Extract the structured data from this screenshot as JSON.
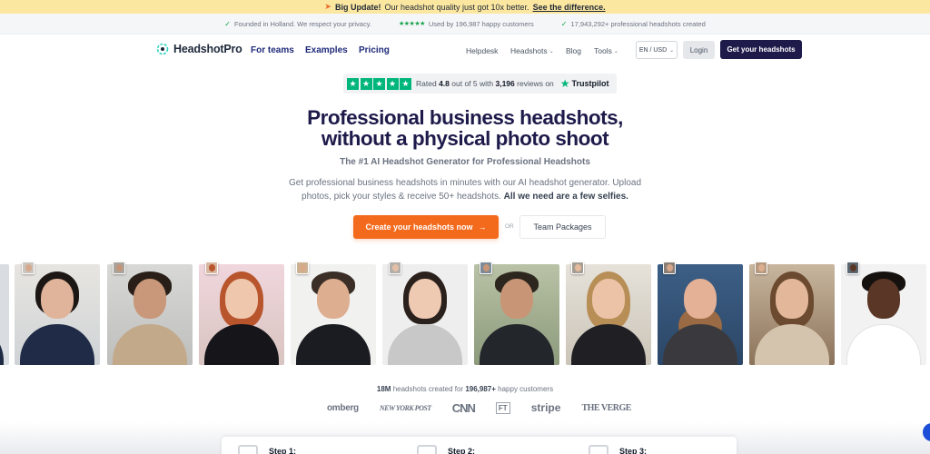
{
  "announcement": {
    "icon": "rocket-icon",
    "bold": "Big Update!",
    "text": "Our headshot quality just got 10x better.",
    "link": "See the difference."
  },
  "trustbar": [
    {
      "icon": "check-icon",
      "text": "Founded in Holland. We respect your privacy."
    },
    {
      "icon": "star-icon",
      "text": "Used by 196,987 happy customers"
    },
    {
      "icon": "check-icon",
      "text": "17,943,292+ professional headshots created"
    }
  ],
  "nav": {
    "logo": "HeadshotPro",
    "primary": [
      "For teams",
      "Examples",
      "Pricing"
    ],
    "secondary": {
      "helpdesk": "Helpdesk",
      "headshots": "Headshots",
      "blog": "Blog",
      "tools": "Tools"
    },
    "language": "EN / USD",
    "login": "Login",
    "cta": "Get your headshots"
  },
  "trustpilot": {
    "prefix": "Rated",
    "rating": "4.8",
    "middle": "out of 5 with",
    "count": "3,196",
    "suffix": "reviews on",
    "brand": "Trustpilot"
  },
  "hero": {
    "title_line1": "Professional business headshots,",
    "title_line2": "without a physical photo shoot",
    "subtitle": "The #1 AI Headshot Generator for Professional Headshots",
    "desc_line1": "Get professional business headshots in minutes with our AI headshot generator. Upload",
    "desc_line2": "photos, pick your styles & receive 50+ headshots.",
    "desc_bold": "All we need are a few selfies.",
    "primary_cta": "Create your headshots now",
    "or": "OR",
    "secondary_cta": "Team Packages"
  },
  "stats": {
    "count": "18M",
    "middle": "headshots created for",
    "customers": "196,987+",
    "suffix": "happy customers"
  },
  "press": [
    "omberg",
    "NEW YORK POST",
    "CNN",
    "FT",
    "stripe",
    "THE VERGE"
  ],
  "steps": [
    "Step 1:",
    "Step 2:",
    "Step 3:"
  ],
  "colors": {
    "brand_navy": "#1e1b4b",
    "accent_orange": "#f36a1d",
    "trustpilot_green": "#00b67a",
    "announce_bg": "#fce7a1"
  }
}
